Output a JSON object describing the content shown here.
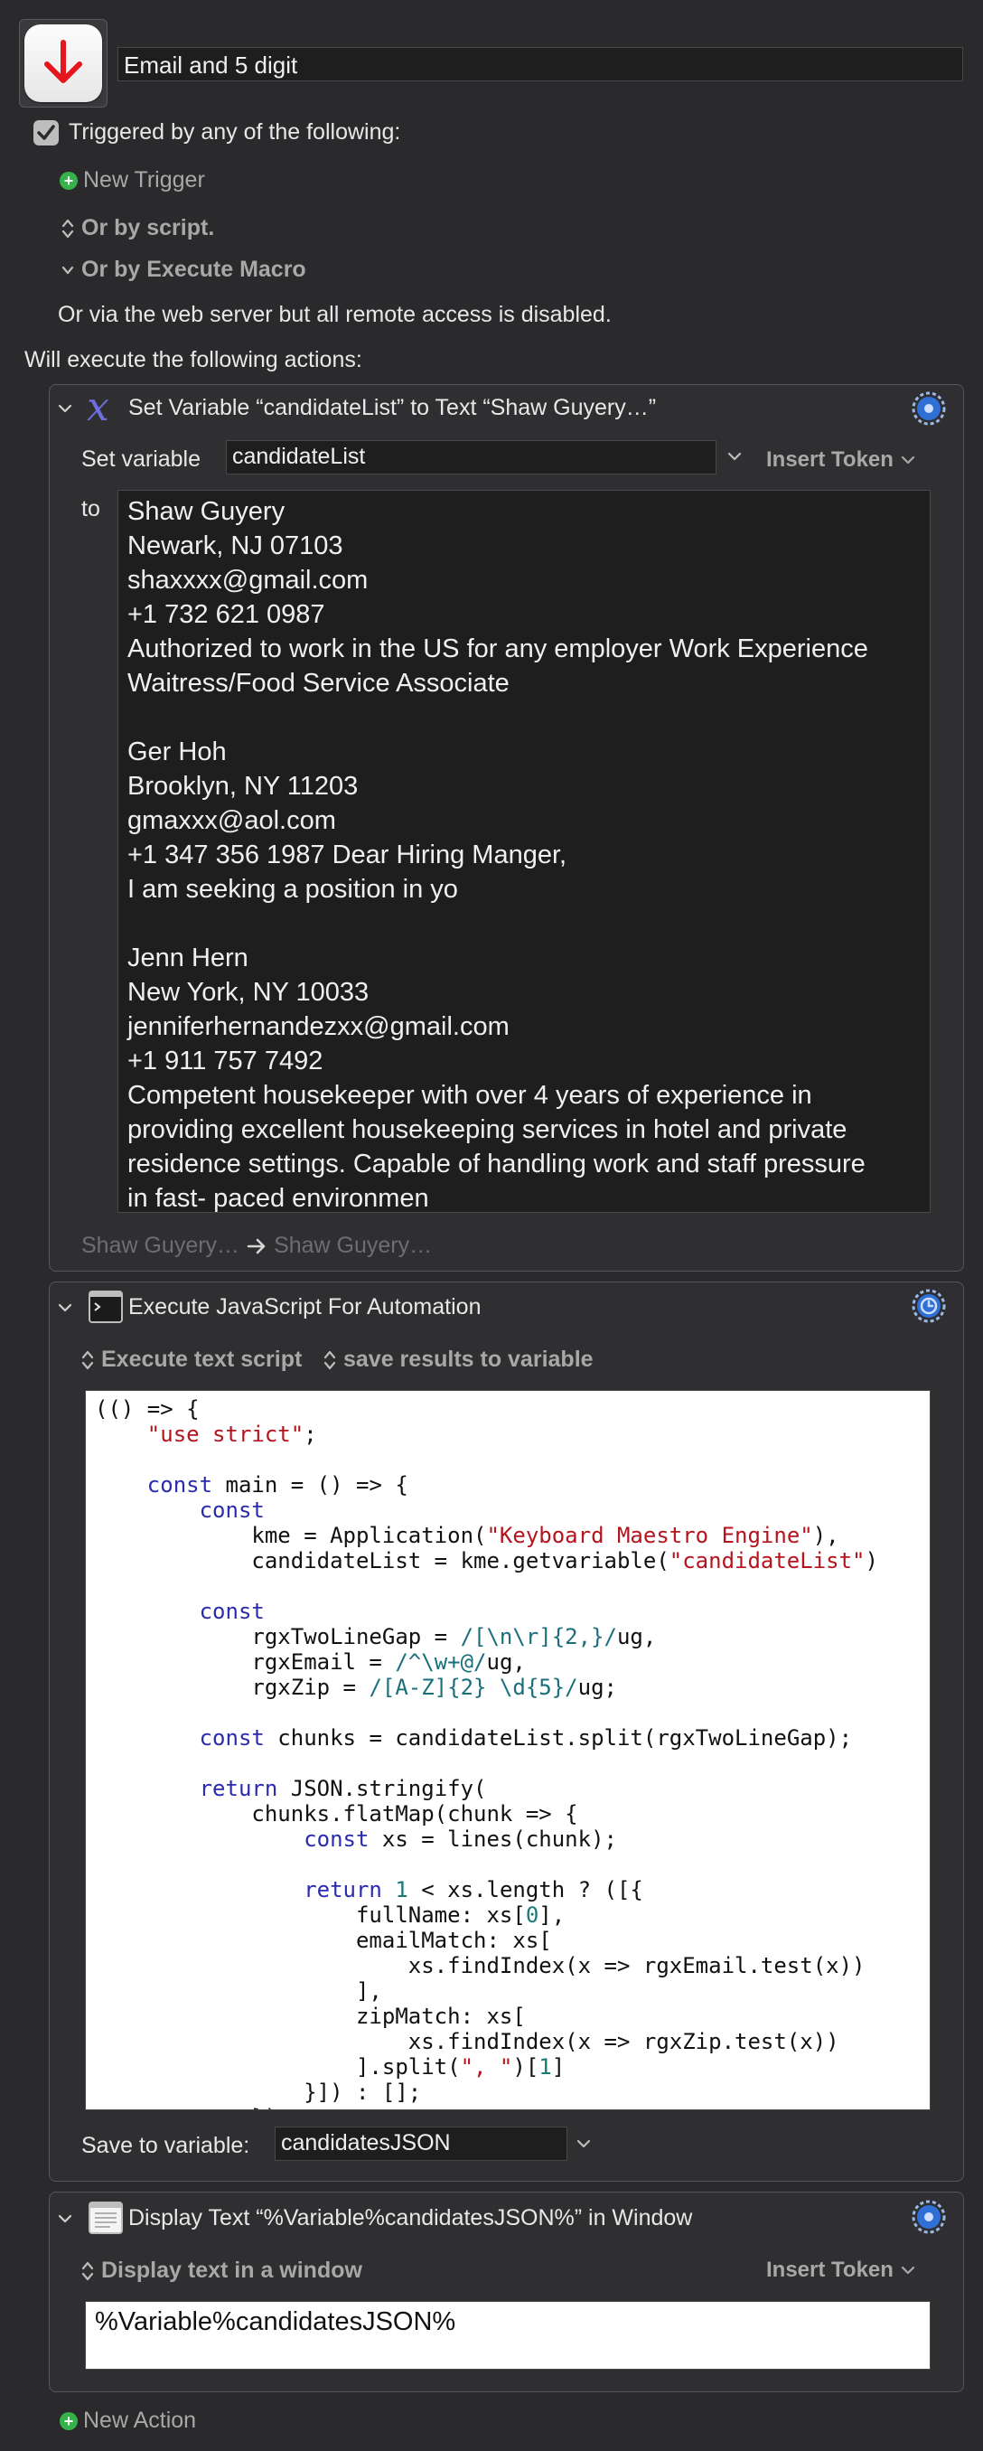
{
  "macro": {
    "name": "Email and 5 digit",
    "icon": "down-arrow-icon",
    "accent_color": "#e5171e"
  },
  "triggers": {
    "checkbox_label": "Triggered by any of the following:",
    "checked": true,
    "new_trigger": "New Trigger",
    "or_by_script": "Or by script.",
    "or_by_execute_macro": "Or by Execute Macro",
    "web_server_note": "Or via the web server but all remote access is disabled."
  },
  "will_execute": "Will execute the following actions:",
  "actions": {
    "set_variable": {
      "title": "Set Variable “candidateList” to Text “Shaw Guyery…”",
      "set_variable_label": "Set variable",
      "variable_name": "candidateList",
      "insert_token": "Insert Token",
      "to_label": "to",
      "text_value": "Shaw Guyery\nNewark, NJ 07103\nshaxxxx@gmail.com\n+1 732 621 0987\nAuthorized to work in the US for any employer Work Experience\nWaitress/Food Service Associate\n\nGer Hoh\nBrooklyn, NY 11203\ngmaxxx@aol.com\n+1 347 356 1987 Dear Hiring Manger,\nI am seeking a position in yo\n\nJenn Hern\nNew York, NY 10033\njenniferhernandezxx@gmail.com\n+1 911 757 7492\nCompetent housekeeper with over 4 years of experience in\nproviding excellent housekeeping services in hotel and private\nresidence settings. Capable of handling work and staff pressure\nin fast- paced environmen",
      "preview_from": "Shaw Guyery…",
      "preview_to": "Shaw Guyery…"
    },
    "execute_jxa": {
      "title": "Execute JavaScript For Automation",
      "mode": "Execute text script",
      "output": "save results to variable",
      "save_to_label": "Save to variable:",
      "save_to_variable": "candidatesJSON"
    },
    "display_text": {
      "title": "Display Text “%Variable%candidatesJSON%” in Window",
      "mode": "Display text in a window",
      "insert_token": "Insert Token",
      "text_value": "%Variable%candidatesJSON%"
    }
  },
  "new_action": "New Action"
}
